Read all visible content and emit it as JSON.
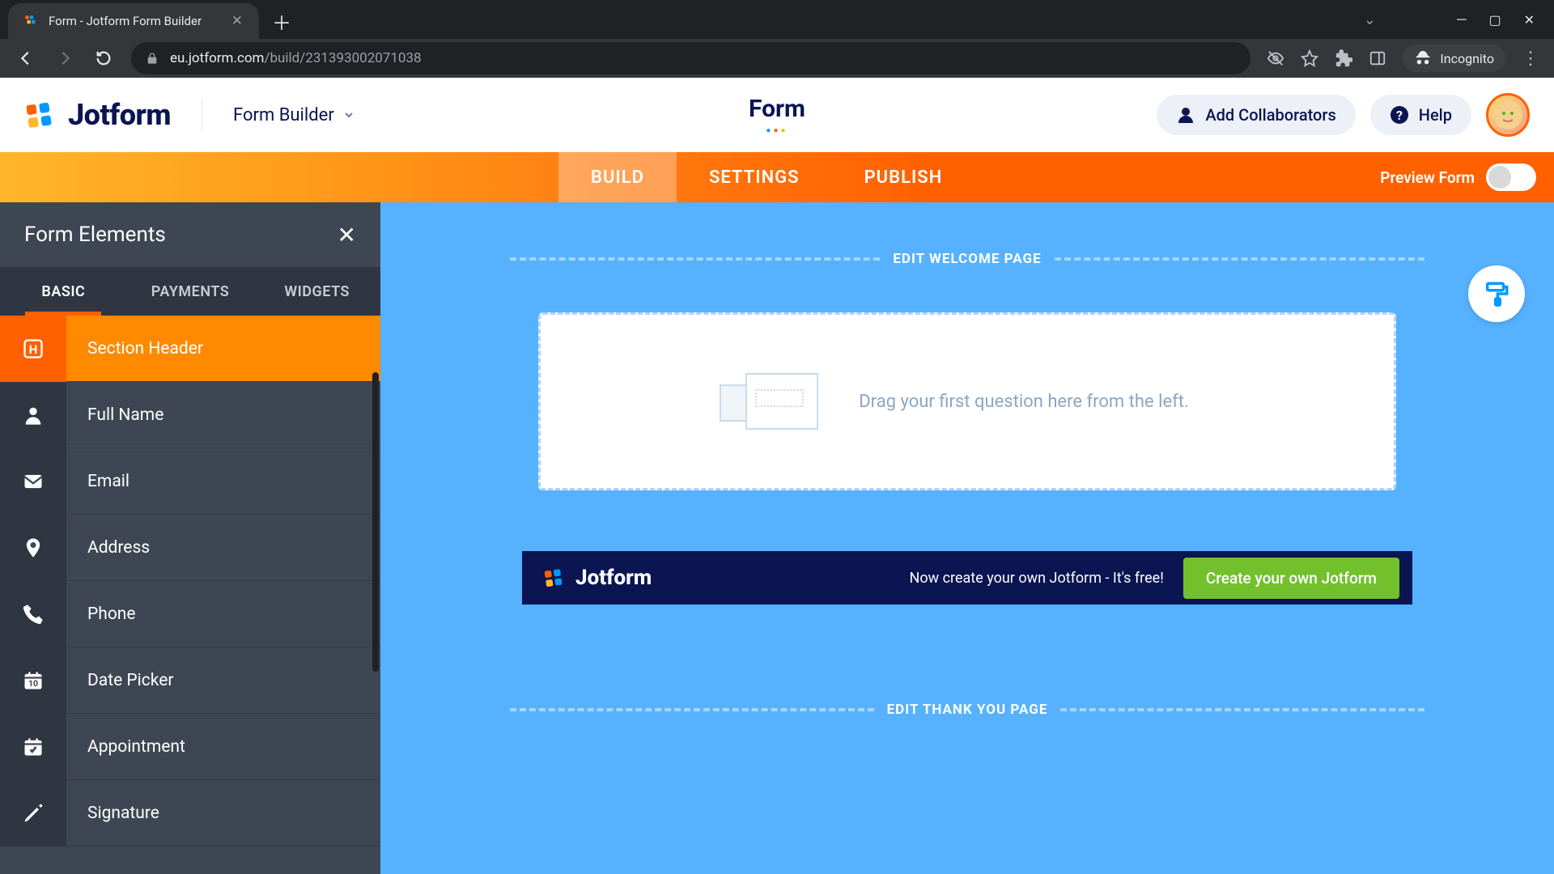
{
  "browser": {
    "tab_title": "Form - Jotform Form Builder",
    "url_host": "eu.jotform.com",
    "url_path": "/build/231393002071038",
    "incognito_label": "Incognito"
  },
  "header": {
    "logo_text": "Jotform",
    "builder_label": "Form Builder",
    "form_title": "Form",
    "collab_label": "Add Collaborators",
    "help_label": "Help"
  },
  "tabbar": {
    "tabs": [
      "BUILD",
      "SETTINGS",
      "PUBLISH"
    ],
    "active_index": 0,
    "preview_label": "Preview Form"
  },
  "left_panel": {
    "title": "Form Elements",
    "tabs": [
      "BASIC",
      "PAYMENTS",
      "WIDGETS"
    ],
    "active_tab": 0,
    "items": [
      {
        "label": "Section Header",
        "icon": "H",
        "active": true
      },
      {
        "label": "Full Name",
        "icon": "person"
      },
      {
        "label": "Email",
        "icon": "mail"
      },
      {
        "label": "Address",
        "icon": "pin"
      },
      {
        "label": "Phone",
        "icon": "phone"
      },
      {
        "label": "Date Picker",
        "icon": "cal"
      },
      {
        "label": "Appointment",
        "icon": "check-cal"
      },
      {
        "label": "Signature",
        "icon": "pen"
      }
    ]
  },
  "canvas": {
    "welcome_label": "EDIT WELCOME PAGE",
    "dropzone_text": "Drag your first question here from the left.",
    "promo_text": "Now create your own Jotform - It's free!",
    "promo_button": "Create your own Jotform",
    "promo_logo": "Jotform",
    "thankyou_label": "EDIT THANK YOU PAGE"
  }
}
